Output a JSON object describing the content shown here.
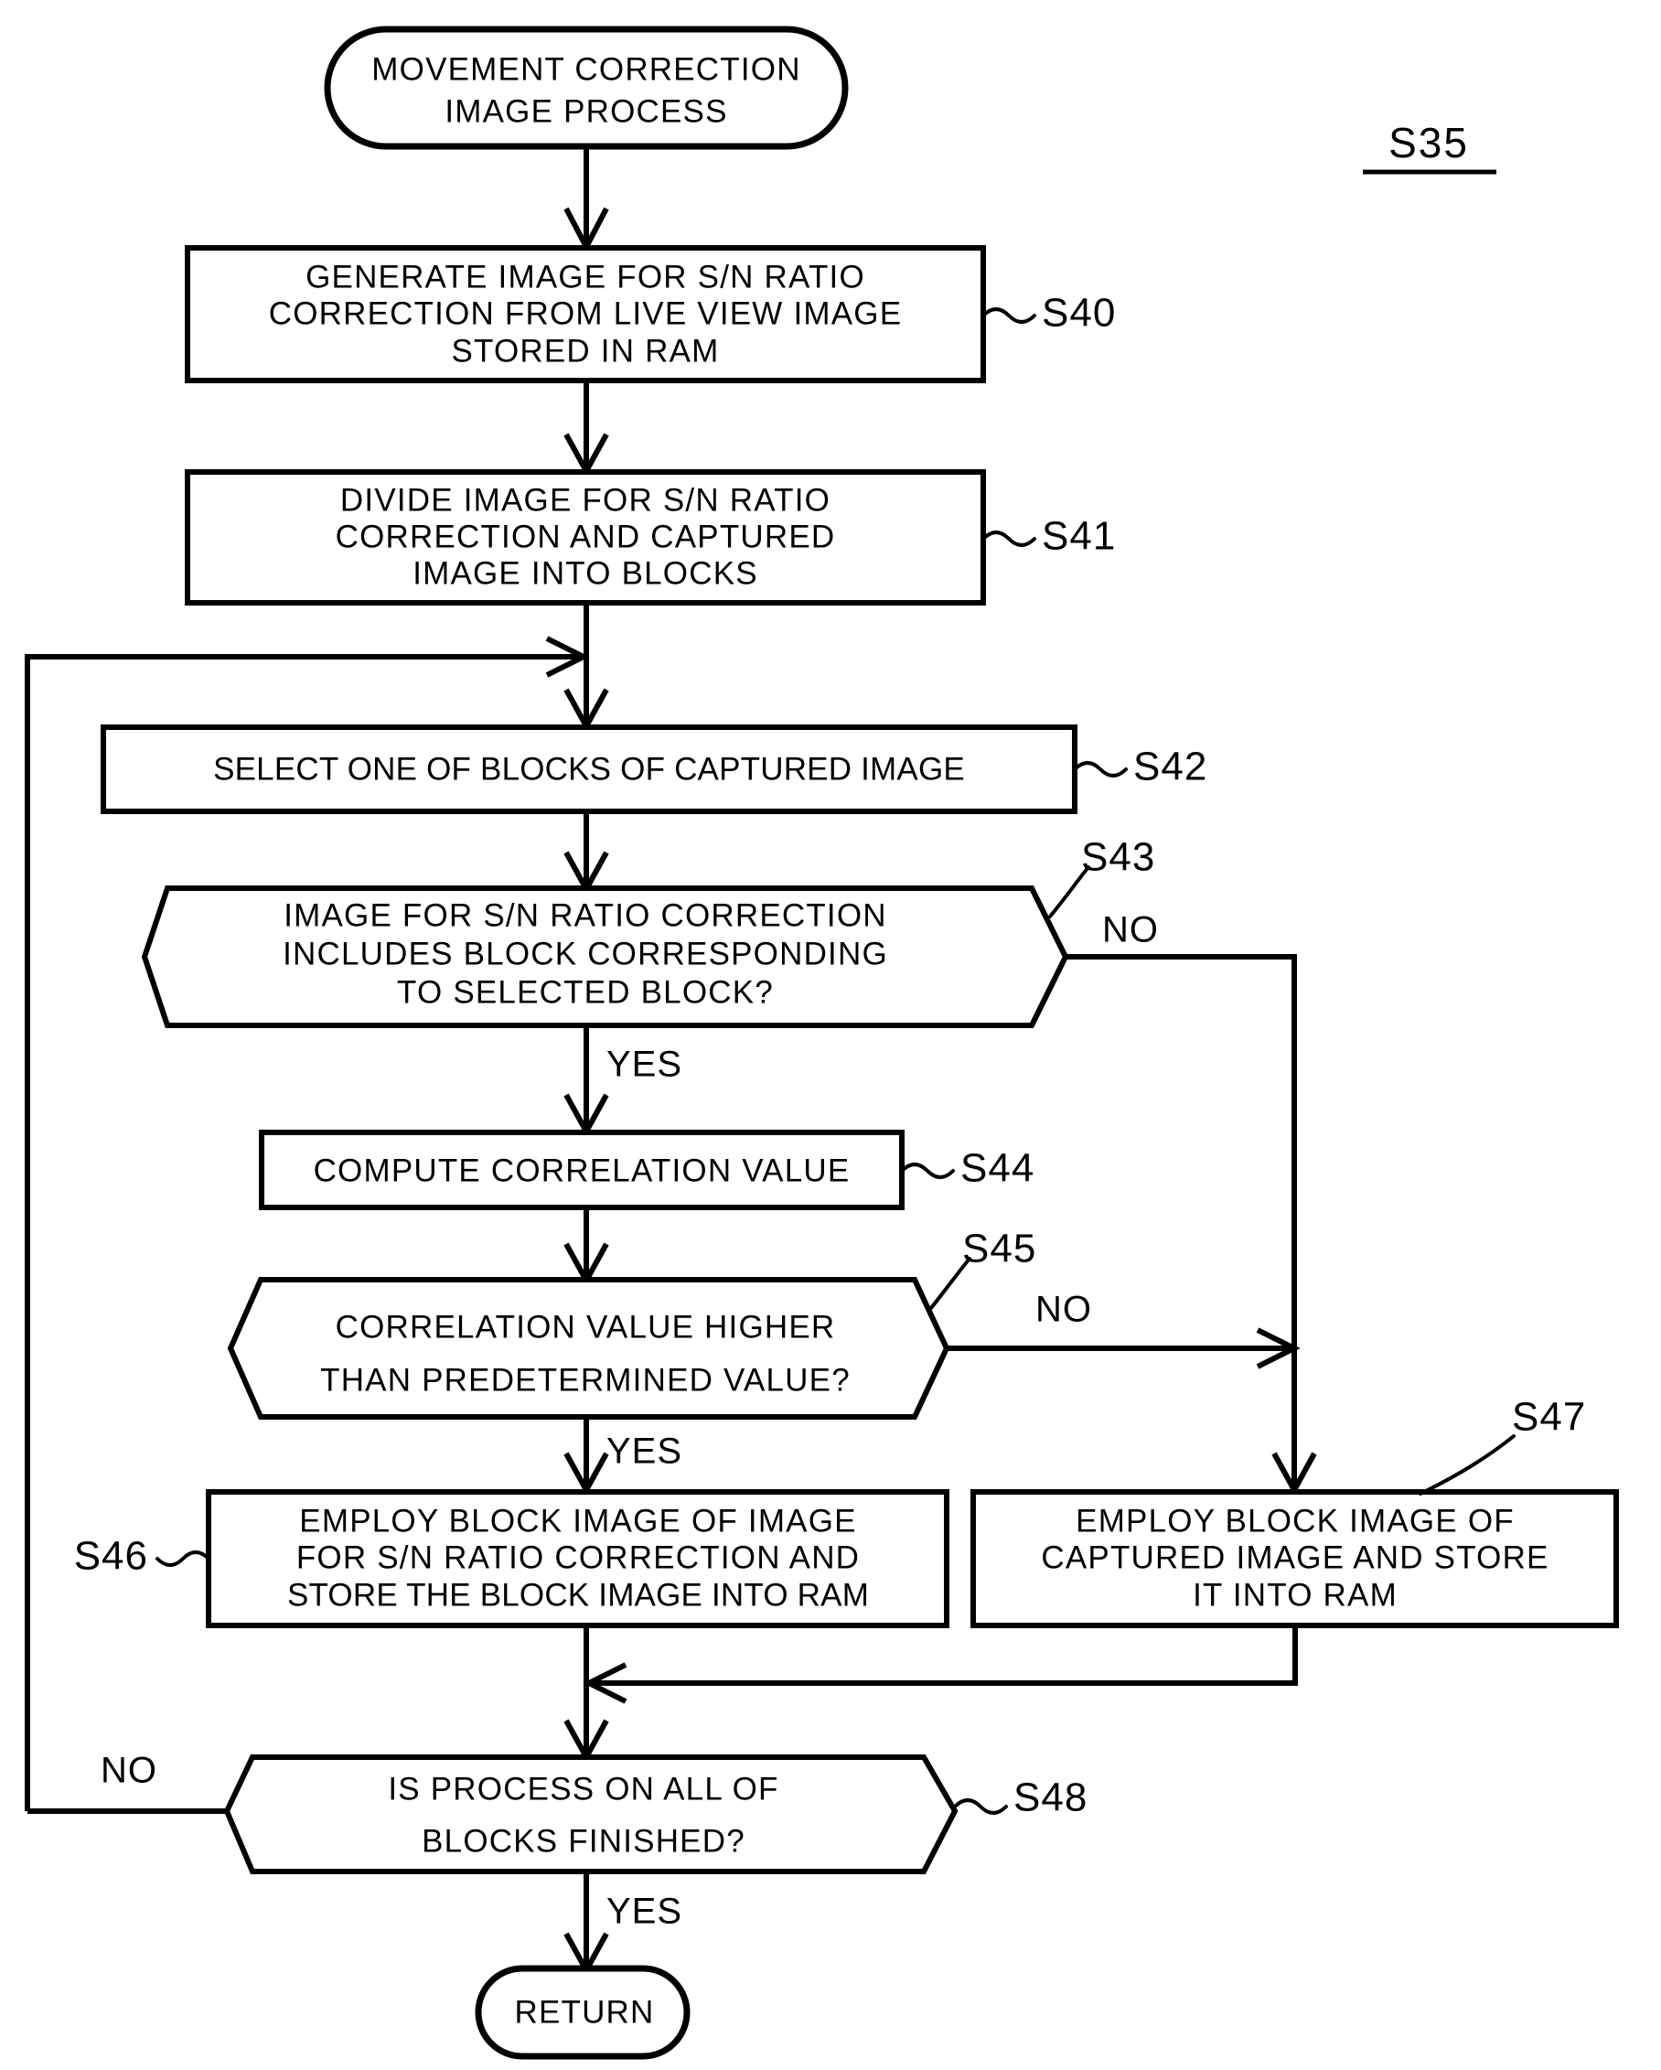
{
  "figure": {
    "label": "S35"
  },
  "nodes": {
    "start": {
      "id": "start",
      "shape": "terminator",
      "lines": [
        "MOVEMENT CORRECTION",
        "IMAGE PROCESS"
      ]
    },
    "s40": {
      "id": "S40",
      "shape": "process",
      "step": "S40",
      "lines": [
        "GENERATE IMAGE FOR S/N RATIO",
        "CORRECTION FROM LIVE VIEW IMAGE",
        "STORED IN RAM"
      ]
    },
    "s41": {
      "id": "S41",
      "shape": "process",
      "step": "S41",
      "lines": [
        "DIVIDE IMAGE FOR S/N RATIO",
        "CORRECTION AND CAPTURED",
        "IMAGE INTO BLOCKS"
      ]
    },
    "s42": {
      "id": "S42",
      "shape": "process",
      "step": "S42",
      "lines": [
        "SELECT ONE OF BLOCKS OF CAPTURED IMAGE"
      ]
    },
    "s43": {
      "id": "S43",
      "shape": "decision",
      "step": "S43",
      "lines": [
        "IMAGE FOR S/N RATIO CORRECTION",
        "INCLUDES BLOCK CORRESPONDING",
        "TO SELECTED BLOCK?"
      ],
      "branch_no": "NO",
      "branch_yes": "YES"
    },
    "s44": {
      "id": "S44",
      "shape": "process",
      "step": "S44",
      "lines": [
        "COMPUTE CORRELATION VALUE"
      ]
    },
    "s45": {
      "id": "S45",
      "shape": "decision",
      "step": "S45",
      "lines": [
        "CORRELATION VALUE HIGHER",
        "THAN PREDETERMINED VALUE?"
      ],
      "branch_no": "NO",
      "branch_yes": "YES"
    },
    "s46": {
      "id": "S46",
      "shape": "process",
      "step": "S46",
      "lines": [
        "EMPLOY BLOCK IMAGE OF IMAGE",
        "FOR S/N RATIO CORRECTION AND",
        "STORE THE BLOCK IMAGE INTO RAM"
      ]
    },
    "s47": {
      "id": "S47",
      "shape": "process",
      "step": "S47",
      "lines": [
        "EMPLOY BLOCK IMAGE OF",
        "CAPTURED IMAGE AND STORE",
        "IT INTO RAM"
      ]
    },
    "s48": {
      "id": "S48",
      "shape": "decision",
      "step": "S48",
      "lines": [
        "IS PROCESS ON ALL OF",
        "BLOCKS FINISHED?"
      ],
      "branch_no": "NO",
      "branch_yes": "YES"
    },
    "end": {
      "id": "end",
      "shape": "terminator",
      "lines": [
        "RETURN"
      ]
    }
  },
  "colors": {
    "stroke": "#000000",
    "fill": "#ffffff",
    "background": "#ffffff"
  }
}
